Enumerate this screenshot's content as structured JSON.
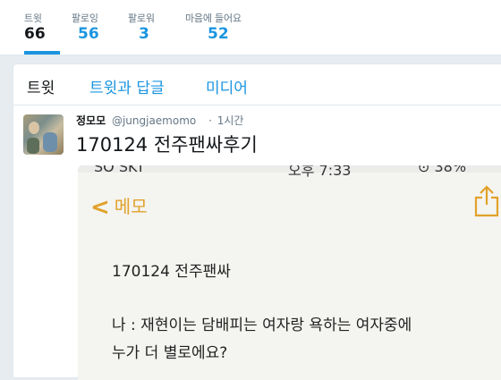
{
  "stats": [
    {
      "label": "트윗",
      "value": "66"
    },
    {
      "label": "팔로잉",
      "value": "56"
    },
    {
      "label": "팔로워",
      "value": "3"
    },
    {
      "label": "마음에 들어요",
      "value": "52"
    }
  ],
  "tabs": [
    "트윗",
    "트윗과 답글",
    "미디어"
  ],
  "tweet": {
    "author_name": "정모모",
    "handle": "@jungjaemomo",
    "separator": "·",
    "time": "1시간",
    "text": "170124 전주팬싸후기"
  },
  "screenshot": {
    "status_left": "SO SKT",
    "status_center": "오후 7:33",
    "status_right": "⊙ 38%",
    "back_label": "메모",
    "memo_title": "170124 전주팬싸",
    "line1": "나 : 재현이는 담배피는 여자랑 욕하는 여자중에",
    "line2": "누가 더 별로에요?"
  },
  "colors": {
    "accent": "#1b95e0",
    "memo_accent": "#e1a22a",
    "background": "#e6ecf0"
  }
}
